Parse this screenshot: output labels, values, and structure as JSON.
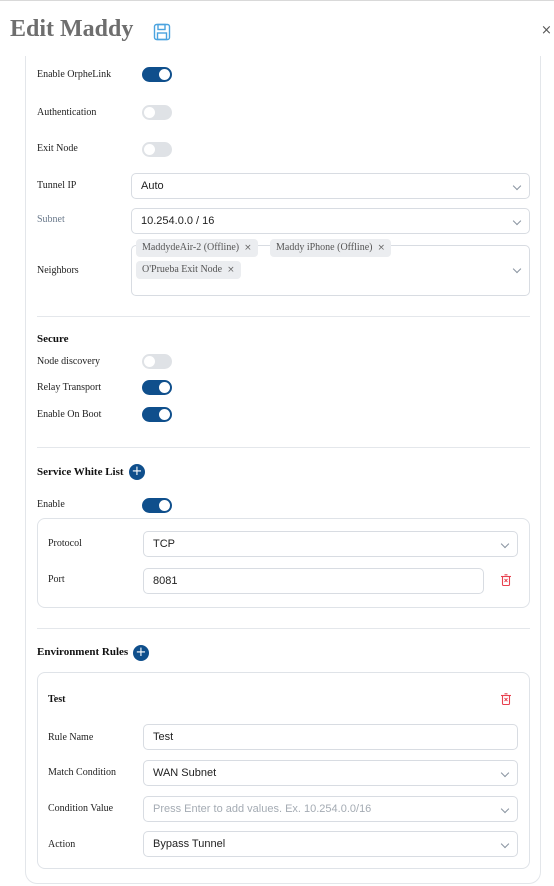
{
  "header": {
    "title": "Edit Maddy",
    "save_icon": "save-icon",
    "close_label": "×"
  },
  "colors": {
    "accent": "#0f4f8c",
    "danger": "#e8414f",
    "save_icon": "#4aa3df"
  },
  "general": {
    "enable_orphelink": {
      "label": "Enable OrpheLink",
      "on": true
    },
    "authentication": {
      "label": "Authentication",
      "on": false
    },
    "exit_node": {
      "label": "Exit Node",
      "on": false
    },
    "tunnel_ip": {
      "label": "Tunnel IP",
      "value": "Auto"
    },
    "subnet": {
      "label": "Subnet",
      "value": "10.254.0.0 / 16"
    },
    "neighbors": {
      "label": "Neighbors",
      "tags": [
        "MaddydeAir-2 (Offline)",
        "Maddy iPhone (Offline)",
        "O'Prueba Exit Node"
      ],
      "remove_glyph": "×"
    }
  },
  "secure": {
    "title": "Secure",
    "node_discovery": {
      "label": "Node discovery",
      "on": false
    },
    "relay_transport": {
      "label": "Relay Transport",
      "on": true
    },
    "enable_on_boot": {
      "label": "Enable On Boot",
      "on": true
    }
  },
  "whitelist": {
    "title": "Service White List",
    "add_glyph": "+",
    "enable": {
      "label": "Enable",
      "on": true
    },
    "protocol": {
      "label": "Protocol",
      "value": "TCP"
    },
    "port": {
      "label": "Port",
      "value": "8081"
    }
  },
  "env_rules": {
    "title": "Environment Rules",
    "add_glyph": "+",
    "rule": {
      "title": "Test",
      "rule_name": {
        "label": "Rule Name",
        "value": "Test"
      },
      "match_condition": {
        "label": "Match Condition",
        "value": "WAN Subnet"
      },
      "condition_value": {
        "label": "Condition Value",
        "placeholder": "Press Enter to add values. Ex. 10.254.0.0/16"
      },
      "action": {
        "label": "Action",
        "value": "Bypass Tunnel"
      }
    }
  }
}
